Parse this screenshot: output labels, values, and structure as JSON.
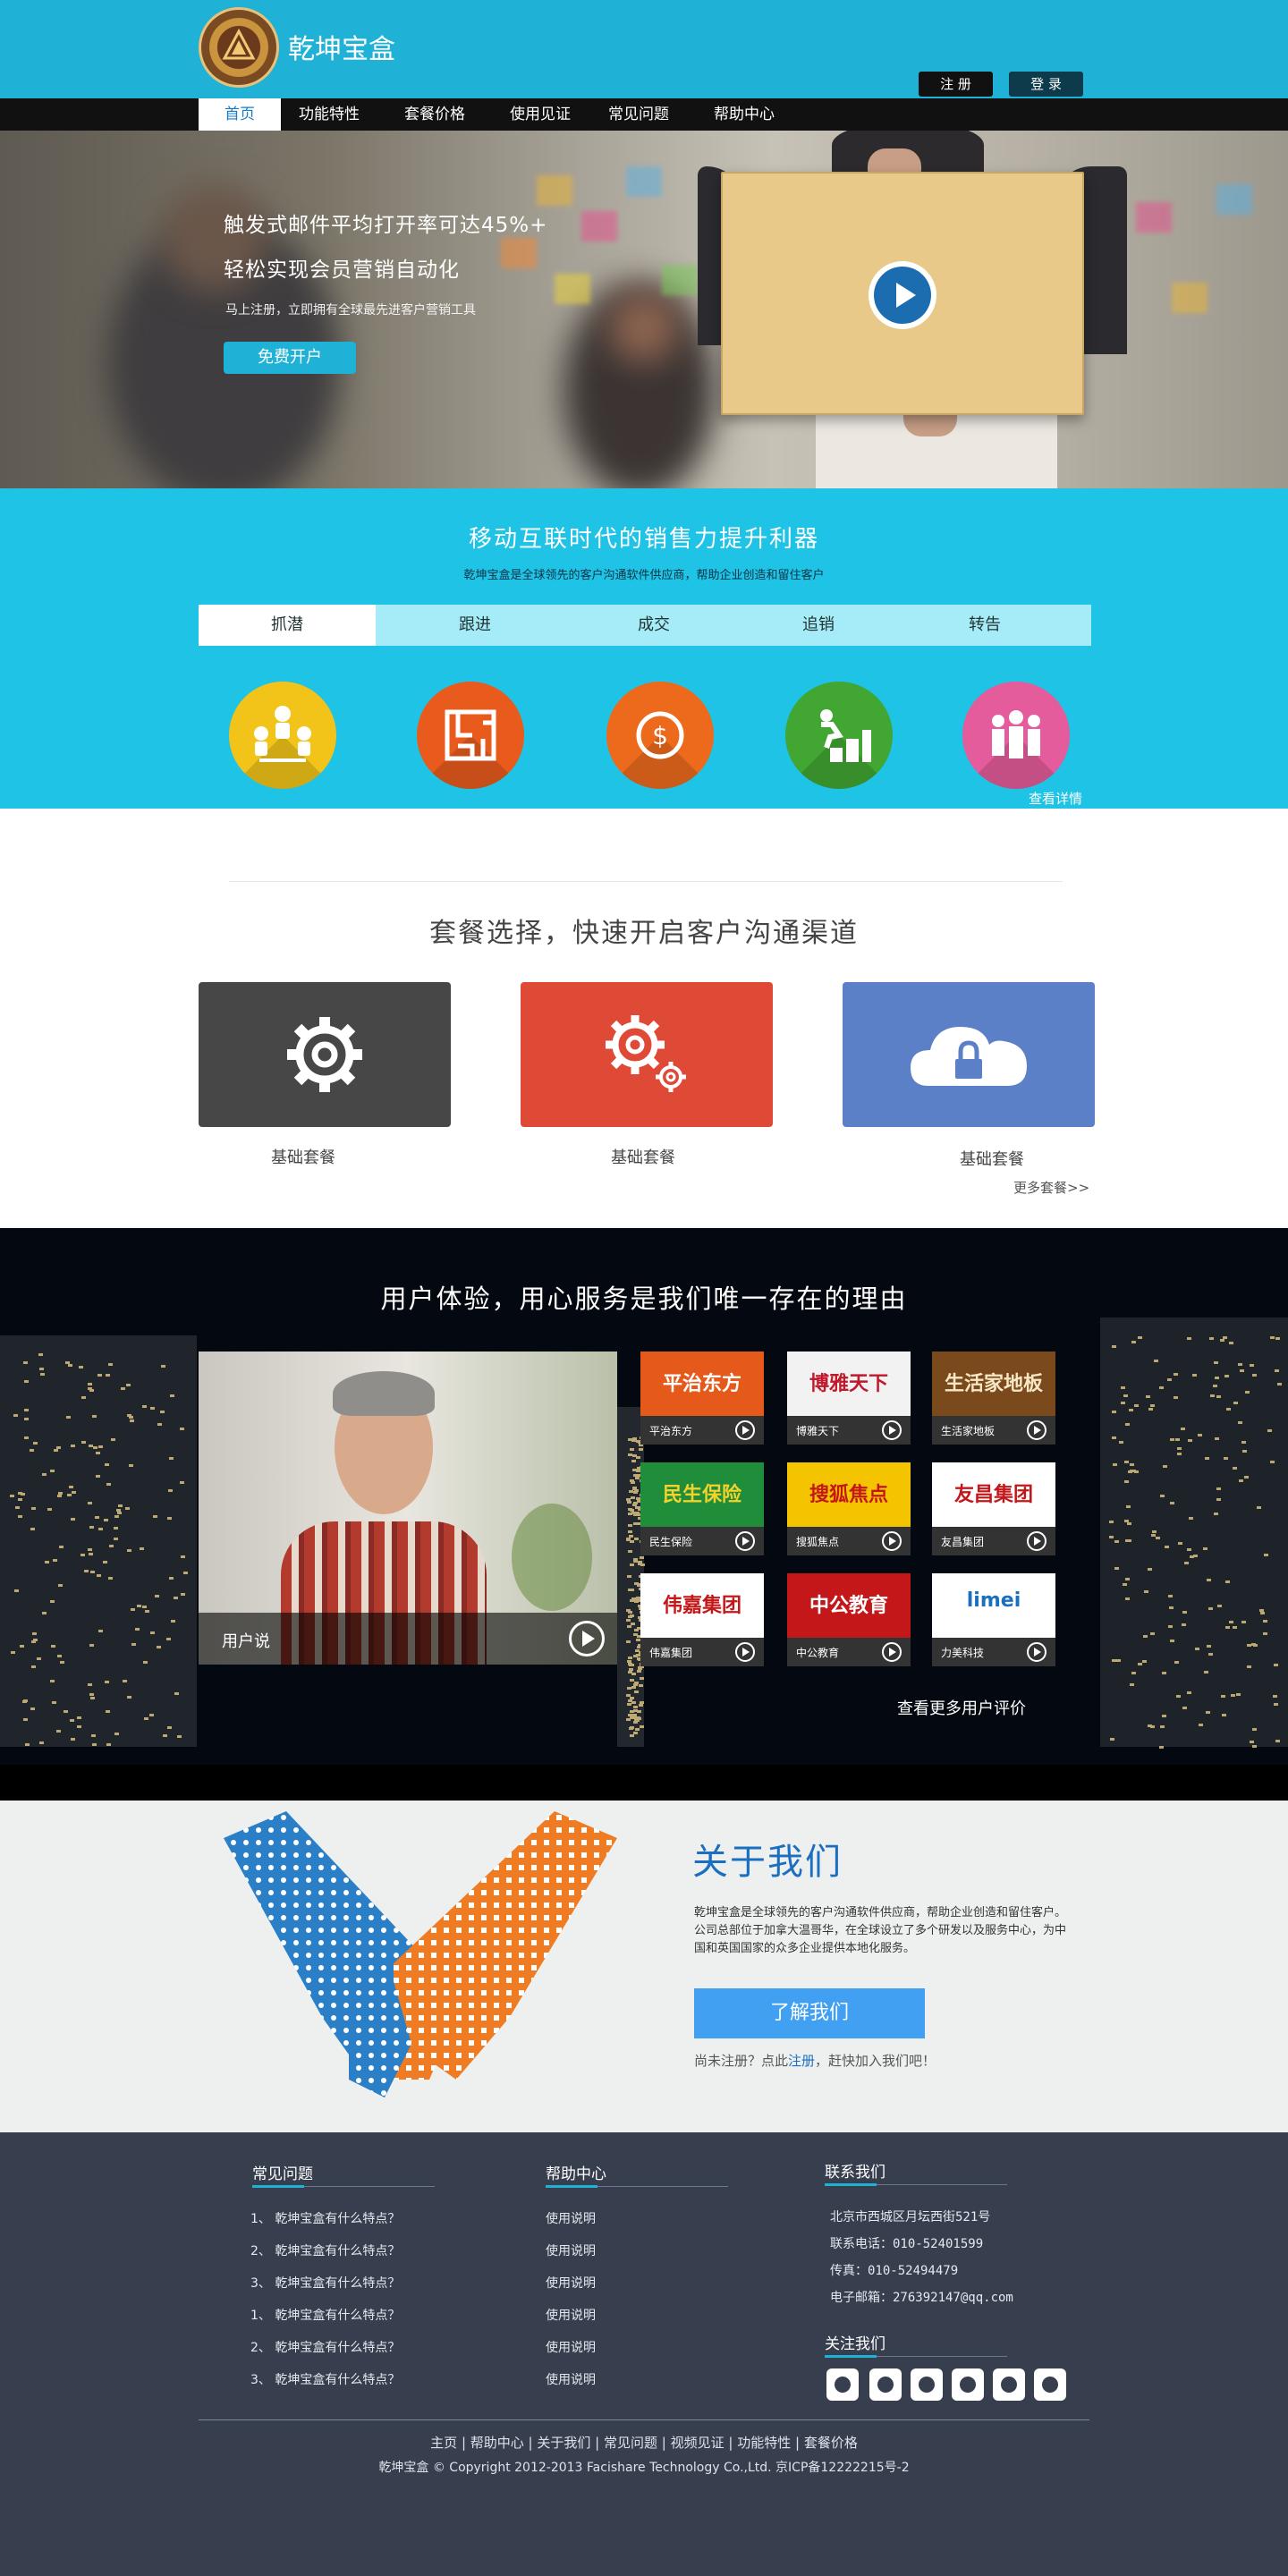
{
  "header": {
    "brand": "乾坤宝盒",
    "register": "注 册",
    "login": "登 录",
    "nav": [
      {
        "label": "首页",
        "active": true
      },
      {
        "label": "功能特性",
        "active": false
      },
      {
        "label": "套餐价格",
        "active": false
      },
      {
        "label": "使用见证",
        "active": false
      },
      {
        "label": "常见问题",
        "active": false
      },
      {
        "label": "帮助中心",
        "active": false
      }
    ]
  },
  "hero": {
    "line1": "触发式邮件平均打开率可达45%+",
    "line2": "轻松实现会员营销自动化",
    "subtitle": "马上注册，立即拥有全球最先进客户营销工具",
    "cta": "免费开户"
  },
  "mobile": {
    "title": "移动互联时代的销售力提升利器",
    "subtitle": "乾坤宝盒是全球领先的客户沟通软件供应商，帮助企业创造和留住客户",
    "tabs": [
      {
        "label": "抓潜",
        "active": true
      },
      {
        "label": "跟进",
        "active": false
      },
      {
        "label": "成交",
        "active": false
      },
      {
        "label": "追销",
        "active": false
      },
      {
        "label": "转告",
        "active": false
      }
    ],
    "features": [
      {
        "icon": "team-icon",
        "color": "#f2c41a"
      },
      {
        "icon": "maze-icon",
        "color": "#e85b1c"
      },
      {
        "icon": "dollar-icon",
        "color": "#ed6a1c"
      },
      {
        "icon": "growth-icon",
        "color": "#41a632"
      },
      {
        "icon": "group-icon",
        "color": "#e45c9b"
      }
    ],
    "view_detail": "查看详情"
  },
  "packages": {
    "title": "套餐选择，快速开启客户沟通渠道",
    "items": [
      {
        "label": "基础套餐",
        "icon": "gear-icon",
        "color": "#474747"
      },
      {
        "label": "基础套餐",
        "icon": "gears-icon",
        "color": "#df4a37"
      },
      {
        "label": "基础套餐",
        "icon": "cloud-lock-icon",
        "color": "#5b80c8"
      }
    ],
    "more": "更多套餐>>"
  },
  "testimonials": {
    "title": "用户体验，用心服务是我们唯一存在的理由",
    "video_label": "用户说",
    "brands": [
      {
        "name": "平治东方",
        "logo": "平治东方",
        "bg": "#e55a1b",
        "fg": "#ffffff"
      },
      {
        "name": "博雅天下",
        "logo": "博雅天下",
        "bg": "#f2f2f2",
        "fg": "#c0192c"
      },
      {
        "name": "生活家地板",
        "logo": "生活家地板",
        "bg": "#7a4a1c",
        "fg": "#f7e7c4"
      },
      {
        "name": "民生保险",
        "logo": "民生保险",
        "bg": "#1f8d3a",
        "fg": "#f3d22b"
      },
      {
        "name": "搜狐焦点",
        "logo": "搜狐焦点",
        "bg": "#f5c400",
        "fg": "#c4171a"
      },
      {
        "name": "友昌集团",
        "logo": "友昌集团",
        "bg": "#ffffff",
        "fg": "#c4171a"
      },
      {
        "name": "伟嘉集团",
        "logo": "伟嘉集团",
        "bg": "#ffffff",
        "fg": "#c4171a"
      },
      {
        "name": "中公教育",
        "logo": "中公教育",
        "bg": "#c4171a",
        "fg": "#ffffff"
      },
      {
        "name": "力美科技",
        "logo": "limei",
        "bg": "#ffffff",
        "fg": "#1a6fc0"
      }
    ],
    "more": "查看更多用户评价"
  },
  "about": {
    "title": "关于我们",
    "text": "乾坤宝盒是全球领先的客户沟通软件供应商，帮助企业创造和留住客户。公司总部位于加拿大温哥华，在全球设立了多个研发以及服务中心，为中国和英国国家的众多企业提供本地化服务。",
    "button": "了解我们",
    "note_prefix": "尚未注册？点此",
    "note_link": "注册",
    "note_suffix": "，赶快加入我们吧！"
  },
  "footer": {
    "faq": {
      "title": "常见问题",
      "items": [
        "1、 乾坤宝盒有什么特点？",
        "2、 乾坤宝盒有什么特点？",
        "3、 乾坤宝盒有什么特点？",
        "1、 乾坤宝盒有什么特点？",
        "2、 乾坤宝盒有什么特点？",
        "3、 乾坤宝盒有什么特点？"
      ]
    },
    "help": {
      "title": "帮助中心",
      "items": [
        "使用说明",
        "使用说明",
        "使用说明",
        "使用说明",
        "使用说明",
        "使用说明"
      ]
    },
    "contact": {
      "title": "联系我们",
      "lines": [
        "北京市西城区月坛西街521号",
        "联系电话：010-52401599",
        "传真：010-52494479",
        "电子邮箱：276392147@qq.com"
      ]
    },
    "follow": {
      "title": "关注我们",
      "icons": [
        "qq-icon",
        "wechat-icon",
        "message-icon",
        "renren-icon",
        "weibo-icon",
        "baidu-icon"
      ]
    },
    "links": [
      "主页",
      "帮助中心",
      "关于我们",
      "常见问题",
      "视频见证",
      "功能特性",
      "套餐价格"
    ],
    "copyright": "乾坤宝盒  © Copyright 2012-2013 Facishare Technology Co.,Ltd.   京ICP备12222215号-2"
  }
}
